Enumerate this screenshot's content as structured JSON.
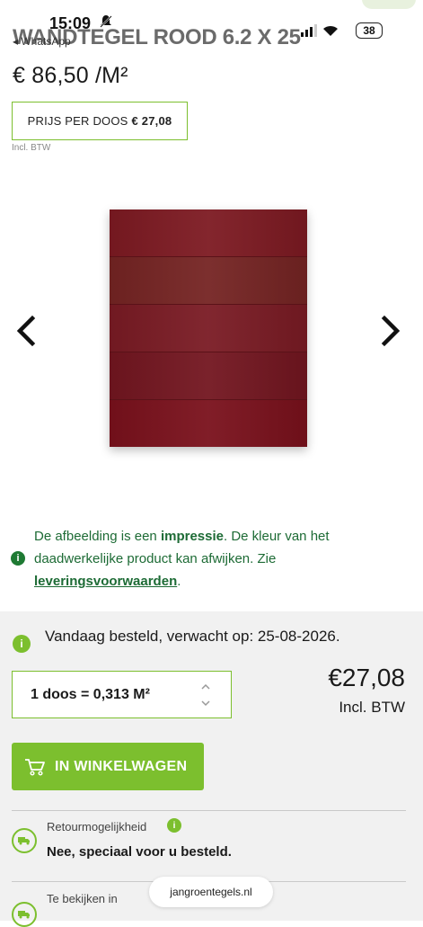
{
  "status_bar": {
    "time": "15:09",
    "back_app": "◂ WhatsApp",
    "battery": "38"
  },
  "header": {
    "title": "WANDTEGEL ROOD 6.2 X 25"
  },
  "price": {
    "main": "€ 86,50 /M²",
    "box_label": "PRIJS PER DOOS",
    "box_value": "€ 27,08",
    "incl": "Incl. BTW"
  },
  "gallery": {
    "tile_colors": [
      "#7d1a22",
      "#752423",
      "#7a1b24",
      "#731620",
      "#7a111c"
    ],
    "prev_icon": "chevron-left-icon",
    "next_icon": "chevron-right-icon"
  },
  "notice": {
    "part1": "De afbeelding is een ",
    "bold1": "impressie",
    "part2": ". De kleur van het daadwerkelijke product kan afwijken. Zie ",
    "link": "leveringsvoorwaarden",
    "part3": "."
  },
  "order": {
    "delivery_text": "Vandaag besteld, verwacht op: 25-08-2026.",
    "quantity": "1 doos = 0,313 M²",
    "total": "€27,08",
    "total_incl": "Incl. BTW",
    "cart_button": "IN WINKELWAGEN"
  },
  "details": {
    "return_label": "Retourmogelijkheid",
    "return_value": "Nee, speciaal voor u besteld.",
    "view_label": "Te bekijken in"
  },
  "browser": {
    "url": "jangroentegels.nl"
  },
  "colors": {
    "accent": "#7cbf2e",
    "notice_text": "#1d6b35",
    "panel_bg": "#f1f1f1"
  }
}
